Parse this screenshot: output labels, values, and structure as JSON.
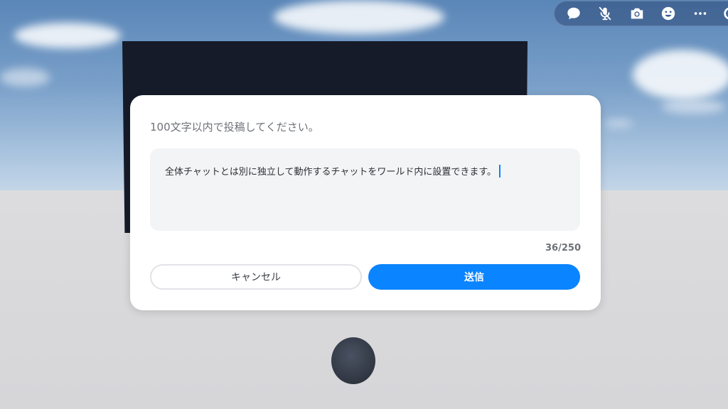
{
  "toolbar": {
    "items": [
      {
        "icon": "chat-bubble-icon"
      },
      {
        "icon": "mic-muted-icon"
      },
      {
        "icon": "camera-icon"
      },
      {
        "icon": "emoji-icon"
      },
      {
        "icon": "more-icon"
      },
      {
        "icon": "partial-icon"
      }
    ]
  },
  "dialog": {
    "prompt": "100文字以内で投稿してください。",
    "input_value": "全体チャットとは別に独立して動作するチャットをワールド内に設置できます。",
    "counter": "36/250",
    "cancel_label": "キャンセル",
    "send_label": "送信"
  },
  "colors": {
    "accent": "#0a84ff",
    "dialog_bg": "#ffffff",
    "input_bg": "#f3f4f6",
    "board": "#151b29"
  }
}
